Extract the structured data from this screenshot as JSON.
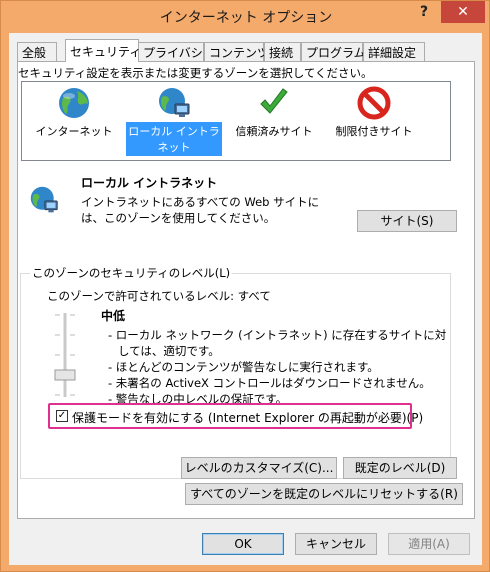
{
  "window": {
    "title": "インターネット オプション",
    "help": "?",
    "close": "✕"
  },
  "tabs": [
    {
      "label": "全般"
    },
    {
      "label": "セキュリティ"
    },
    {
      "label": "プライバシー"
    },
    {
      "label": "コンテンツ"
    },
    {
      "label": "接続"
    },
    {
      "label": "プログラム"
    },
    {
      "label": "詳細設定"
    }
  ],
  "zones": {
    "instruction": "セキュリティ設定を表示または変更するゾーンを選択してください。",
    "items": [
      {
        "label": "インターネット",
        "icon": "globe-icon"
      },
      {
        "label": "ローカル イントラネット",
        "icon": "intranet-globe-icon"
      },
      {
        "label": "信頼済みサイト",
        "icon": "checkmark-icon"
      },
      {
        "label": "制限付きサイト",
        "icon": "prohibited-icon"
      }
    ],
    "selected_index": 1
  },
  "zone_info": {
    "name": "ローカル イントラネット",
    "description": "イントラネットにあるすべての Web サイトには、このゾーンを使用してください。",
    "sites_button": "サイト(S)"
  },
  "security_level": {
    "group_title": "このゾーンのセキュリティのレベル(L)",
    "allowed": "このゾーンで許可されているレベル: すべて",
    "level_name": "中低",
    "descriptions": [
      "- ローカル ネットワーク (イントラネット) に存在するサイトに対しては、適切です。",
      "- ほとんどのコンテンツが警告なしに実行されます。",
      "- 未署名の ActiveX コントロールはダウンロードされません。",
      "- 警告なしの中レベルの保証です。"
    ],
    "slider_level": "中低",
    "protected_mode": {
      "label": "保護モードを有効にする (Internet Explorer の再起動が必要)(P)",
      "checked": true
    },
    "custom_button": "レベルのカスタマイズ(C)...",
    "default_button": "既定のレベル(D)"
  },
  "reset_all_button": "すべてのゾーンを既定のレベルにリセットする(R)",
  "footer": {
    "ok": "OK",
    "cancel": "キャンセル",
    "apply": "適用(A)"
  },
  "colors": {
    "accent_title": "#f4aa6b",
    "close": "#c7463b",
    "selection": "#3399ff",
    "highlight_box": "#e0308f"
  }
}
